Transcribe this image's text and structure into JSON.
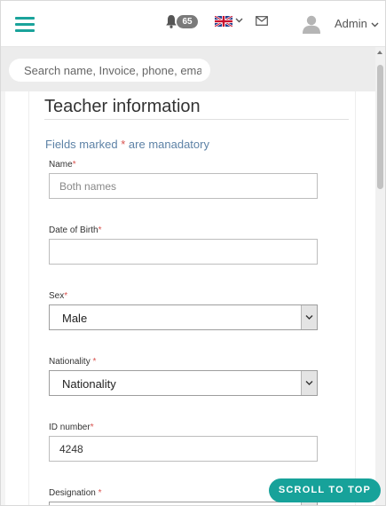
{
  "header": {
    "notification_count": "65",
    "user_name": "Admin",
    "accent_color": "#1aa39b"
  },
  "search": {
    "placeholder": "Search name, Invoice, phone, ema"
  },
  "form": {
    "title": "Teacher information",
    "note_prefix": "Fields marked ",
    "note_asterisk": "*",
    "note_suffix": " are manadatory",
    "fields": [
      {
        "label": "Name",
        "required_mark": "*",
        "type": "text",
        "value": "",
        "placeholder": "Both names"
      },
      {
        "label": "Date of Birth",
        "required_mark": "*",
        "type": "text",
        "value": "",
        "placeholder": ""
      },
      {
        "label": "Sex",
        "required_mark": "*",
        "type": "select",
        "value": "Male"
      },
      {
        "label": "Nationality ",
        "required_mark": "*",
        "type": "select",
        "value": "Nationality"
      },
      {
        "label": "ID number",
        "required_mark": "*",
        "type": "text",
        "value": "4248",
        "placeholder": ""
      },
      {
        "label": "Designation ",
        "required_mark": "*",
        "type": "select",
        "value": ""
      }
    ]
  },
  "scroll_top_label": "SCROLL TO TOP",
  "icons": {
    "menu": "hamburger-icon",
    "bell": "bell-icon",
    "flag": "uk-flag-icon",
    "mail": "envelope-icon",
    "user": "user-avatar-icon"
  }
}
